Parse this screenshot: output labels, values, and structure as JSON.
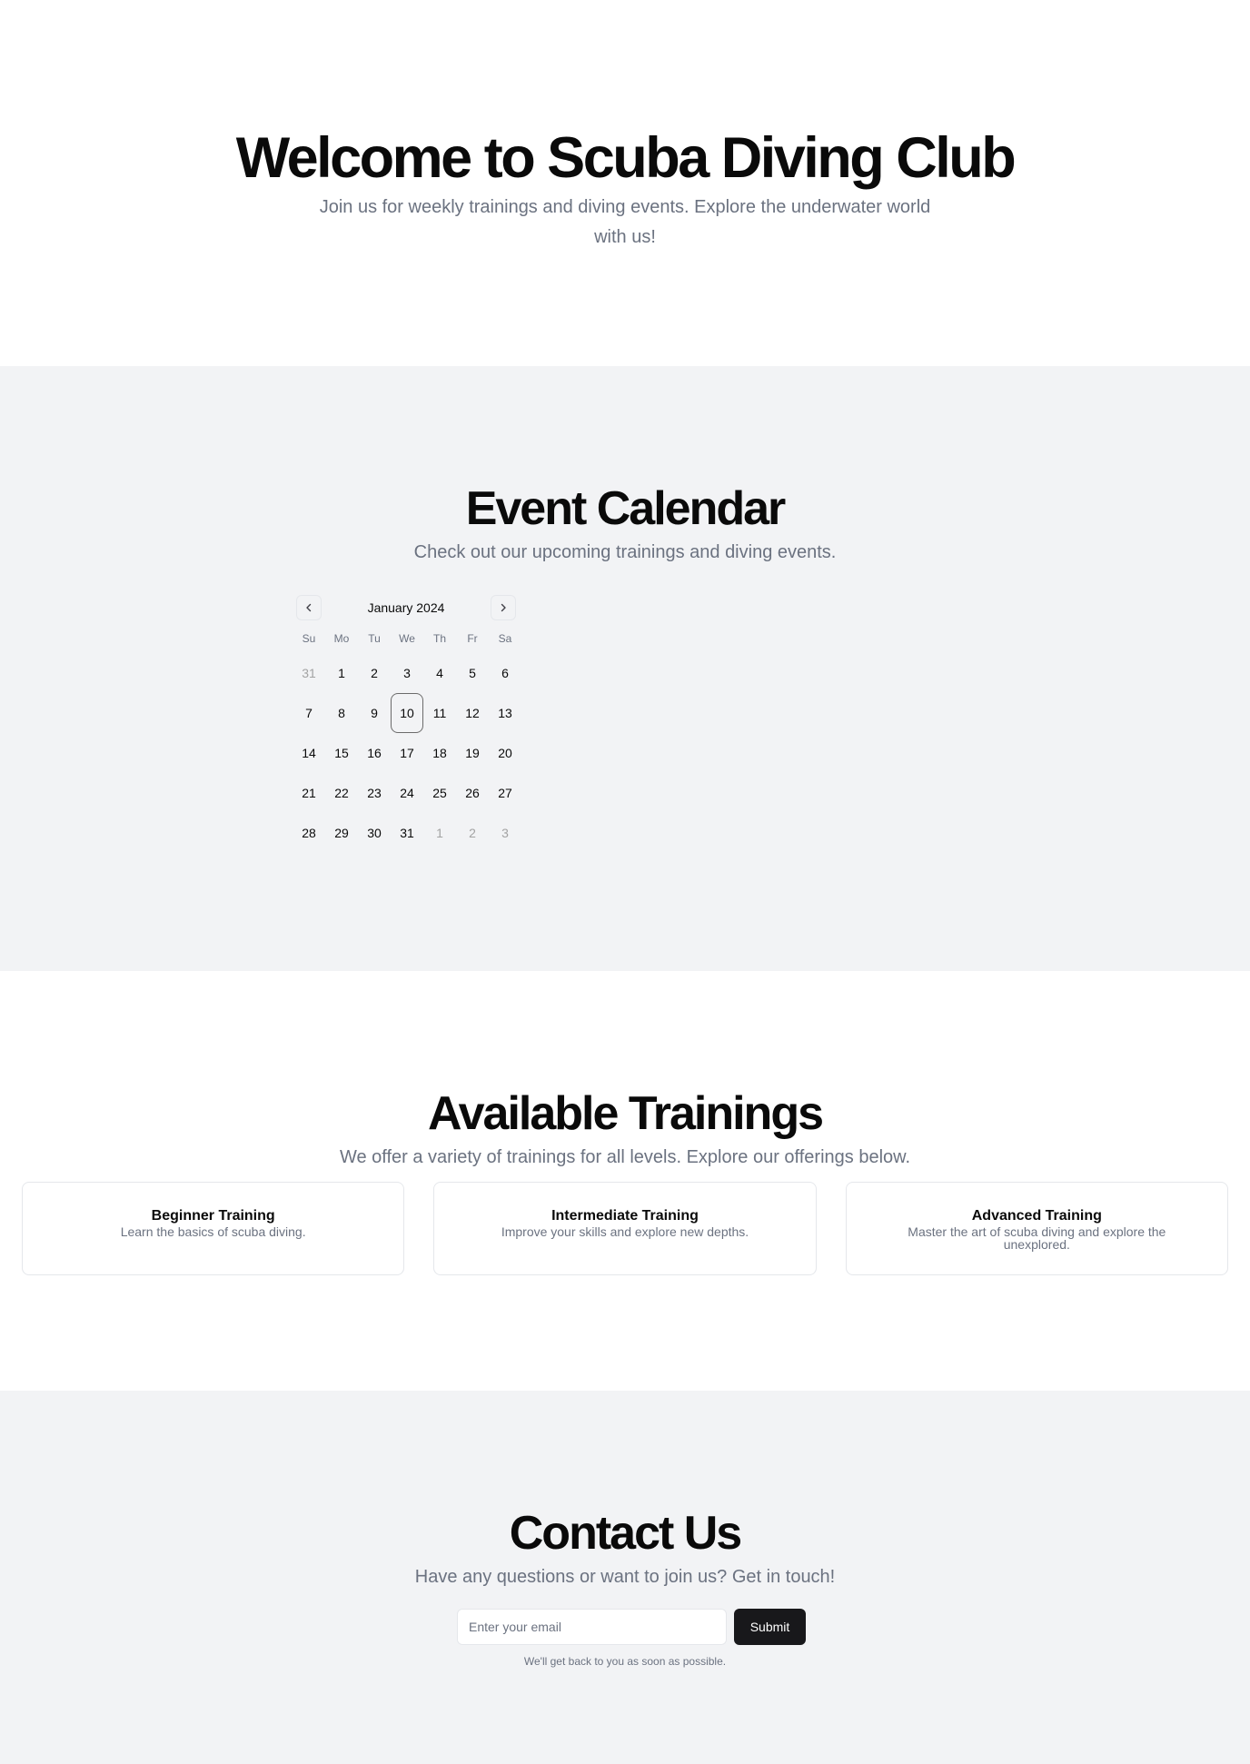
{
  "hero": {
    "title": "Welcome to Scuba Diving Club",
    "subtitle": "Join us for weekly trainings and diving events. Explore the underwater world with us!"
  },
  "calendar_section": {
    "title": "Event Calendar",
    "subtitle": "Check out our upcoming trainings and diving events.",
    "month_label": "January 2024",
    "prev_icon": "chevron-left-icon",
    "next_icon": "chevron-right-icon",
    "weekdays": [
      "Su",
      "Mo",
      "Tu",
      "We",
      "Th",
      "Fr",
      "Sa"
    ],
    "selected_day": "10",
    "days": [
      {
        "label": "31",
        "outside": true
      },
      {
        "label": "1"
      },
      {
        "label": "2"
      },
      {
        "label": "3"
      },
      {
        "label": "4"
      },
      {
        "label": "5"
      },
      {
        "label": "6"
      },
      {
        "label": "7"
      },
      {
        "label": "8"
      },
      {
        "label": "9"
      },
      {
        "label": "10",
        "selected": true
      },
      {
        "label": "11"
      },
      {
        "label": "12"
      },
      {
        "label": "13"
      },
      {
        "label": "14"
      },
      {
        "label": "15"
      },
      {
        "label": "16"
      },
      {
        "label": "17"
      },
      {
        "label": "18"
      },
      {
        "label": "19"
      },
      {
        "label": "20"
      },
      {
        "label": "21"
      },
      {
        "label": "22"
      },
      {
        "label": "23"
      },
      {
        "label": "24"
      },
      {
        "label": "25"
      },
      {
        "label": "26"
      },
      {
        "label": "27"
      },
      {
        "label": "28"
      },
      {
        "label": "29"
      },
      {
        "label": "30"
      },
      {
        "label": "31"
      },
      {
        "label": "1",
        "outside": true
      },
      {
        "label": "2",
        "outside": true
      },
      {
        "label": "3",
        "outside": true
      }
    ]
  },
  "trainings": {
    "title": "Available Trainings",
    "subtitle": "We offer a variety of trainings for all levels. Explore our offerings below.",
    "cards": [
      {
        "title": "Beginner Training",
        "description": "Learn the basics of scuba diving."
      },
      {
        "title": "Intermediate Training",
        "description": "Improve your skills and explore new depths."
      },
      {
        "title": "Advanced Training",
        "description": "Master the art of scuba diving and explore the unexplored."
      }
    ]
  },
  "contact": {
    "title": "Contact Us",
    "subtitle": "Have any questions or want to join us? Get in touch!",
    "email_placeholder": "Enter your email",
    "email_value": "",
    "submit_label": "Submit",
    "note": "We'll get back to you as soon as possible."
  }
}
